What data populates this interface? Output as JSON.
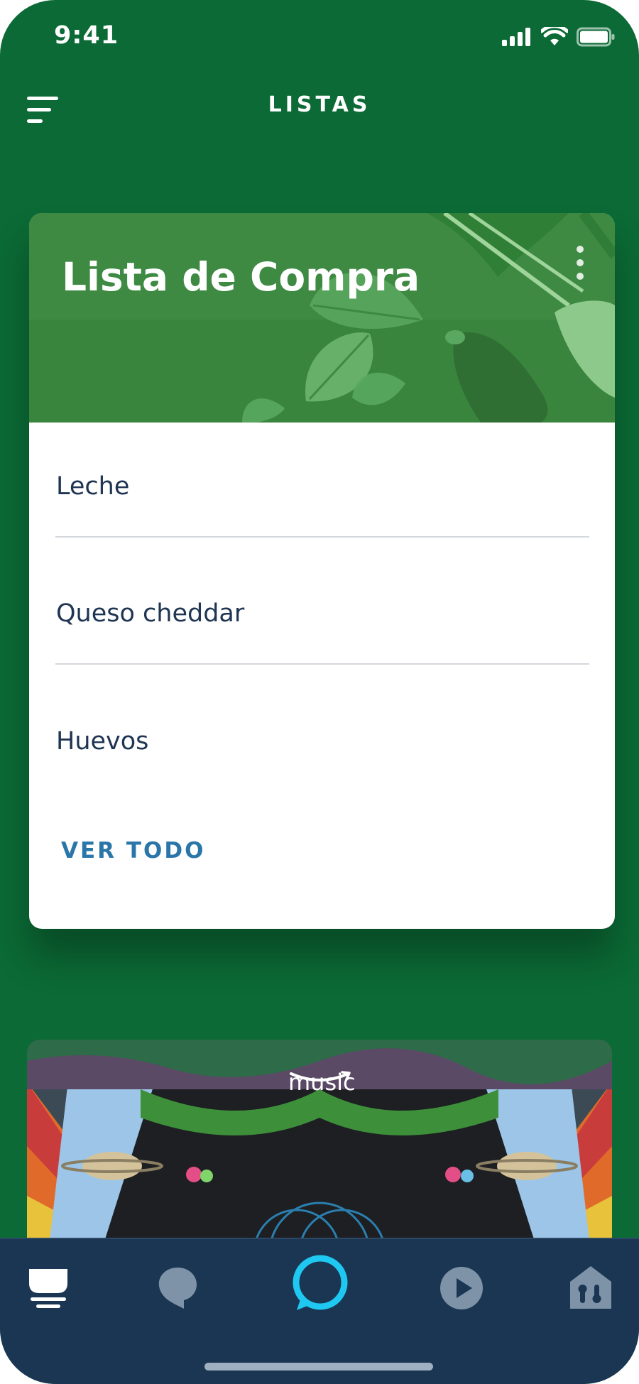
{
  "status_bar": {
    "time": "9:41"
  },
  "header": {
    "title": "LISTAS"
  },
  "shopping_list": {
    "title": "Lista de Compra",
    "items": [
      {
        "label": "Leche"
      },
      {
        "label": "Queso cheddar"
      },
      {
        "label": "Huevos"
      }
    ],
    "see_all_label": "VER TODO"
  },
  "music_card": {
    "logo_text": "music"
  },
  "bottom_nav": {
    "items": [
      {
        "icon": "home-icon",
        "active": true
      },
      {
        "icon": "chat-bubble-icon"
      },
      {
        "icon": "alexa-ring-icon"
      },
      {
        "icon": "play-icon"
      },
      {
        "icon": "smart-home-devices-icon"
      }
    ]
  },
  "colors": {
    "background_green": "#0b6a35",
    "card_header_green": "#3e8a42",
    "item_text": "#1f3552",
    "link_blue": "#2a76a8",
    "nav_background": "#1a3652",
    "alexa_cyan": "#1ec8f0"
  }
}
